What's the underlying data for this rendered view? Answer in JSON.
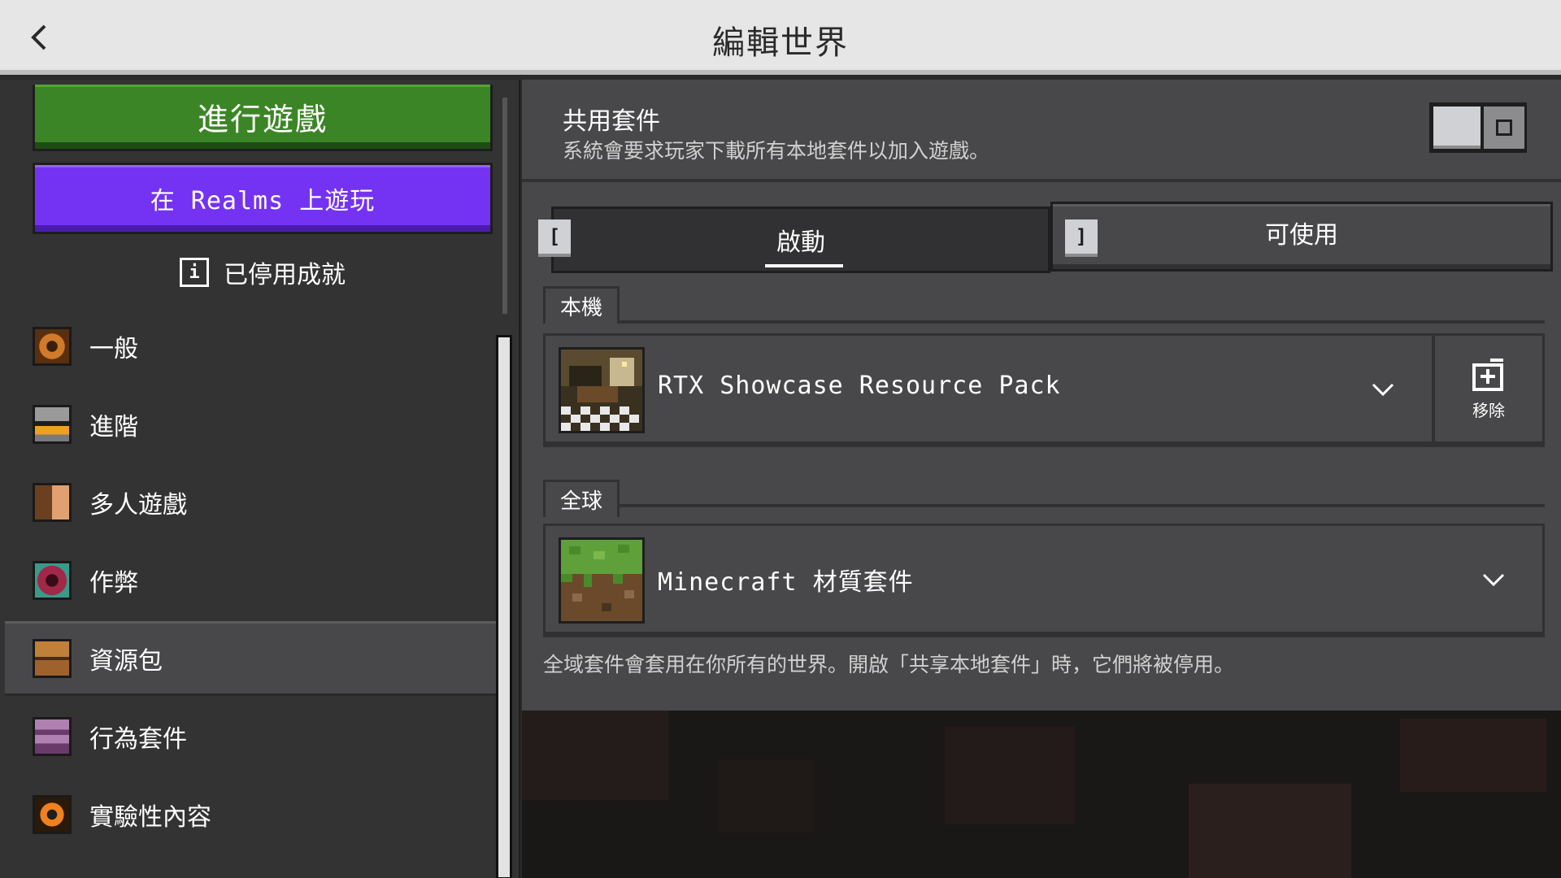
{
  "header": {
    "title": "編輯世界"
  },
  "sidebar": {
    "play_label": "進行遊戲",
    "realms_label": "在 Realms 上遊玩",
    "achievements_label": "已停用成就",
    "items": [
      {
        "label": "一般",
        "icon": "gear-icon",
        "color": "#b5651d"
      },
      {
        "label": "進階",
        "icon": "furnace-icon",
        "color": "#888888"
      },
      {
        "label": "多人遊戲",
        "icon": "players-icon",
        "color": "#c08040"
      },
      {
        "label": "作弊",
        "icon": "command-block-icon",
        "color": "#8a2040"
      },
      {
        "label": "資源包",
        "icon": "chest-icon",
        "color": "#a0622d"
      },
      {
        "label": "行為套件",
        "icon": "behavior-pack-icon",
        "color": "#8a5a8a"
      },
      {
        "label": "實驗性內容",
        "icon": "experimental-icon",
        "color": "#d06020"
      }
    ],
    "active_index": 4
  },
  "shared_packs": {
    "title": "共用套件",
    "description": "系統會要求玩家下載所有本地套件以加入遊戲。",
    "toggle_on": false
  },
  "tabs": {
    "left_bracket": "[",
    "right_bracket": "]",
    "active": "啟動",
    "available": "可使用"
  },
  "local": {
    "label": "本機",
    "pack_name": "RTX Showcase Resource Pack",
    "remove_label": "移除"
  },
  "global": {
    "label": "全球",
    "pack_name": "Minecraft 材質套件",
    "note": "全域套件會套用在你所有的世界。開啟「共享本地套件」時，它們將被停用。"
  },
  "colors": {
    "play_green": "#3c8527",
    "realms_purple": "#7433f2",
    "panel": "#48484a",
    "sidebar": "#333334"
  }
}
